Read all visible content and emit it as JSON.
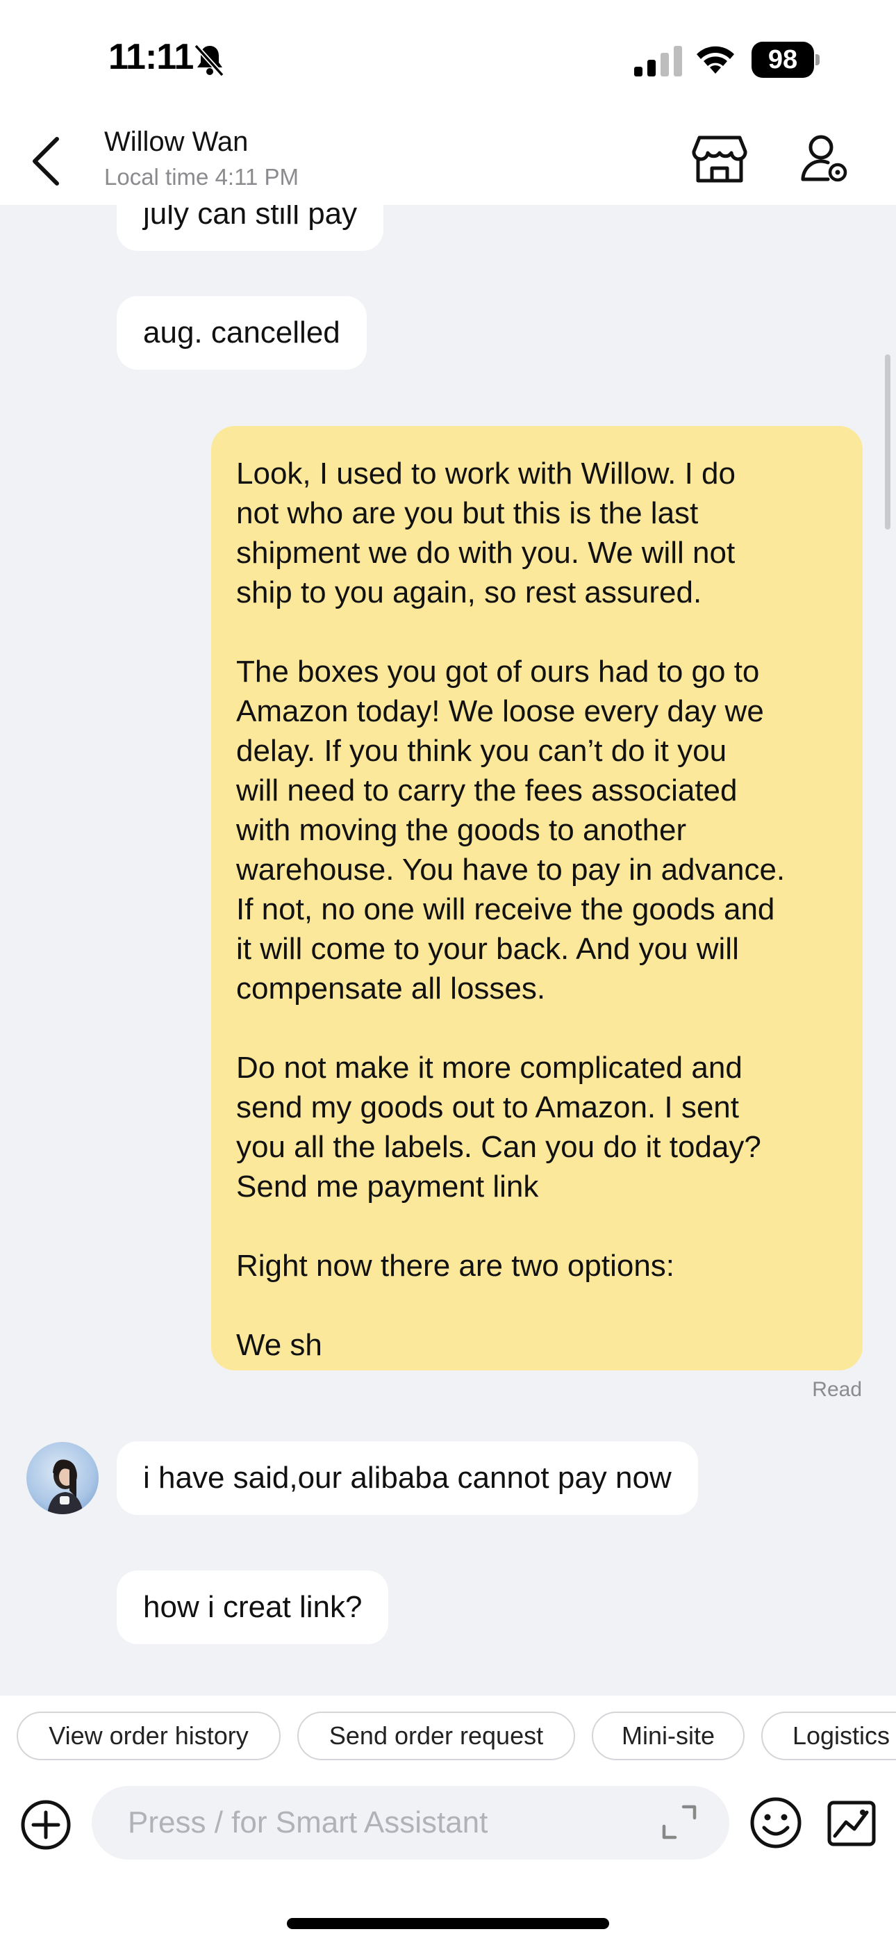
{
  "status_bar": {
    "time": "11:11",
    "battery": "98"
  },
  "header": {
    "contact_name": "Willow Wan",
    "local_time": "Local time 4:11 PM"
  },
  "messages": [
    {
      "direction": "in",
      "text": "july can still pay"
    },
    {
      "direction": "in",
      "text": "aug. cancelled"
    },
    {
      "direction": "out",
      "text": "Look, I used to work with Willow. I do\nnot who are you but this is the last\nshipment we do with you. We will not\nship to you again, so rest assured.\n\nThe boxes you got of ours had to go to\nAmazon today! We loose every day we\ndelay. If you think you can’t do it you\nwill need to carry the fees associated\nwith moving the goods to another\nwarehouse. You have to pay in advance.\nIf not, no one will receive the goods and\nit will come to your back. And you will\ncompensate all losses.\n\nDo not make it more complicated and\nsend my goods out to Amazon. I sent\nyou all the labels. Can you do it today?\nSend me payment link\n\nRight now there are two options:\n\nWe sh"
    },
    {
      "direction": "in",
      "text": "i have said,our alibaba cannot pay now"
    },
    {
      "direction": "in",
      "text": "how i creat link?"
    }
  ],
  "read_status": "Read",
  "quick_actions": [
    "View order history",
    "Send order request",
    "Mini-site",
    "Logistics"
  ],
  "input": {
    "placeholder": "Press / for Smart Assistant",
    "value": ""
  },
  "icons": {
    "back": "chevron-left-icon",
    "store": "store-icon",
    "profile": "profile-settings-icon",
    "plus": "plus-circle-icon",
    "expand": "expand-icon",
    "emoji": "emoji-icon",
    "image": "image-icon",
    "mute": "bell-slash-icon",
    "signal": "cellular-signal-icon",
    "wifi": "wifi-icon"
  },
  "colors": {
    "outgoing_bubble": "#fce89b",
    "incoming_bubble": "#ffffff",
    "chat_background": "#f1f2f5"
  }
}
